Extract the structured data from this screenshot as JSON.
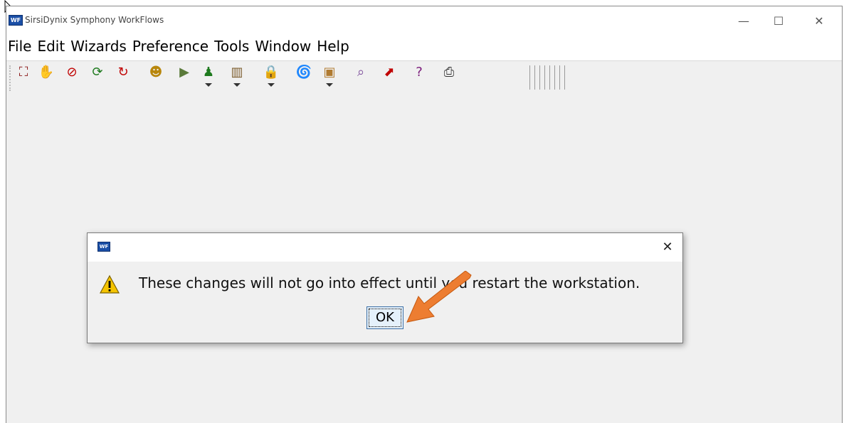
{
  "window": {
    "title": "SirsiDynix Symphony WorkFlows",
    "app_icon_text": "WF",
    "controls": {
      "minimize": "—",
      "maximize": "☐",
      "close": "✕"
    }
  },
  "menu": {
    "items": [
      "File",
      "Edit",
      "Wizards",
      "Preference",
      "Tools",
      "Window",
      "Help"
    ]
  },
  "toolbar": {
    "icons": [
      {
        "name": "stamp-icon",
        "glyph": "⛶",
        "color": "#8b1a1a",
        "dropdown": false
      },
      {
        "name": "hand-book-icon",
        "glyph": "✋",
        "color": "#7a4a9a",
        "dropdown": false
      },
      {
        "name": "no-book-icon",
        "glyph": "⊘",
        "color": "#c00000",
        "dropdown": false
      },
      {
        "name": "user-renew-icon",
        "glyph": "⟳",
        "color": "#1e7a1e",
        "dropdown": false
      },
      {
        "name": "book-renew-icon",
        "glyph": "↻",
        "color": "#c00000",
        "dropdown": false
      },
      {
        "name": "users-group-icon",
        "glyph": "☻",
        "color": "#b8860b",
        "dropdown": false
      },
      {
        "name": "checkin-icon",
        "glyph": "▶",
        "color": "#5a7a3a",
        "dropdown": false
      },
      {
        "name": "user-icon",
        "glyph": "♟",
        "color": "#1e7a1e",
        "dropdown": true
      },
      {
        "name": "book-icon",
        "glyph": "▥",
        "color": "#7a5a2a",
        "dropdown": true
      },
      {
        "name": "lock-icon",
        "glyph": "🔒",
        "color": "#c8a000",
        "dropdown": true
      },
      {
        "name": "tornado-icon",
        "glyph": "🌀",
        "color": "#555555",
        "dropdown": false
      },
      {
        "name": "box-icon",
        "glyph": "▣",
        "color": "#b07a30",
        "dropdown": true
      },
      {
        "name": "search-book-icon",
        "glyph": "⌕",
        "color": "#7a4a9a",
        "dropdown": false
      },
      {
        "name": "report-chart-icon",
        "glyph": "⬈",
        "color": "#c00000",
        "dropdown": false
      },
      {
        "name": "help-book-icon",
        "glyph": "?",
        "color": "#7a1a7a",
        "dropdown": false
      },
      {
        "name": "printer-icon",
        "glyph": "⎙",
        "color": "#333333",
        "dropdown": false
      }
    ]
  },
  "dialog": {
    "icon_text": "WF",
    "close": "✕",
    "message": "These changes will not go into effect until you restart the workstation.",
    "ok_label": "OK"
  },
  "colors": {
    "highlight_arrow": "#ed7d31",
    "dialog_bg": "#f0f0f0",
    "ok_button_bg": "#e5f1fb"
  }
}
